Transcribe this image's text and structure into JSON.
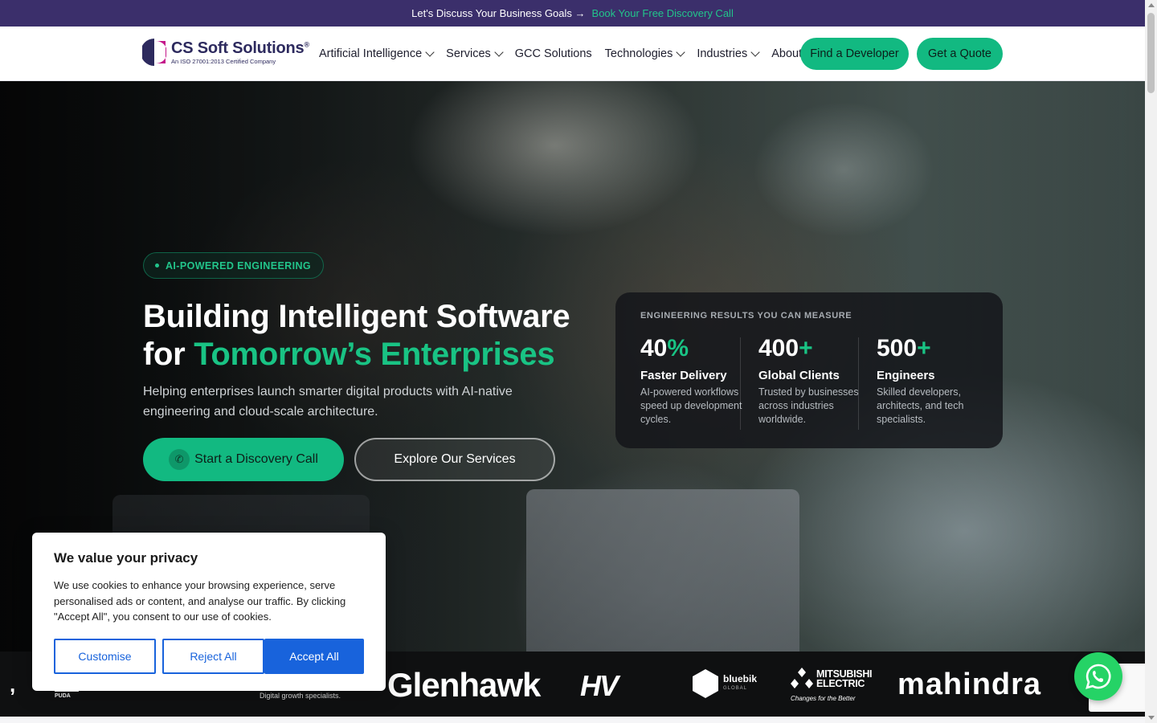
{
  "topbar": {
    "text": "Let's Discuss Your Business Goals →",
    "link": "Book Your Free Discovery Call"
  },
  "header": {
    "logo_name": "CS Soft Solutions",
    "logo_registered": "®",
    "logo_tagline": "An ISO 27001:2013 Certified Company",
    "nav": [
      {
        "label": "Artificial Intelligence",
        "has_dropdown": true
      },
      {
        "label": "Services",
        "has_dropdown": true
      },
      {
        "label": "GCC Solutions",
        "has_dropdown": false
      },
      {
        "label": "Technologies",
        "has_dropdown": true
      },
      {
        "label": "Industries",
        "has_dropdown": true
      },
      {
        "label": "About",
        "has_dropdown": false
      }
    ],
    "find_developer": "Find a Developer",
    "get_quote": "Get a Quote"
  },
  "hero": {
    "badge": "AI-POWERED ENGINEERING",
    "title_line1": "Building Intelligent Software",
    "title_for": "for",
    "title_accent": "Tomorrow’s Enterprises",
    "subtitle": "Helping enterprises launch smarter digital products with AI-native engineering and cloud-scale architecture.",
    "cta_primary": "Start a Discovery Call",
    "cta_secondary": "Explore Our Services"
  },
  "stats": {
    "heading": "ENGINEERING RESULTS YOU CAN MEASURE",
    "items": [
      {
        "value": "40",
        "suffix": "%",
        "label": "Faster Delivery",
        "desc": "AI-powered workflows speed up development cycles."
      },
      {
        "value": "400",
        "suffix": "+",
        "label": "Global Clients",
        "desc": "Trusted by businesses across industries worldwide."
      },
      {
        "value": "500",
        "suffix": "+",
        "label": "Engineers",
        "desc": "Skilled developers, architects, and tech specialists."
      }
    ]
  },
  "logos": {
    "puda": "PUDA",
    "digital_tagline": "Digital growth specialists.",
    "glenhawk": "Glenhawk",
    "hv": "HV",
    "bluebik": "bluebik",
    "bluebik_sub": "GLOBAL",
    "mitsubishi_1": "MITSUBISHI",
    "mitsubishi_2": "ELECTRIC",
    "mitsubishi_tag": "Changes for the Better",
    "mahindra": "mahindra"
  },
  "cookie": {
    "title": "We value your privacy",
    "text": "We use cookies to enhance your browsing experience, serve personalised ads or content, and analyse our traffic. By clicking \"Accept All\", you consent to our use of cookies.",
    "customise": "Customise",
    "reject": "Reject All",
    "accept": "Accept All"
  },
  "colors": {
    "brand_purple": "#3b2f6b",
    "accent_green": "#12b981",
    "cookie_blue": "#1863dc",
    "whatsapp_green": "#25d366"
  }
}
